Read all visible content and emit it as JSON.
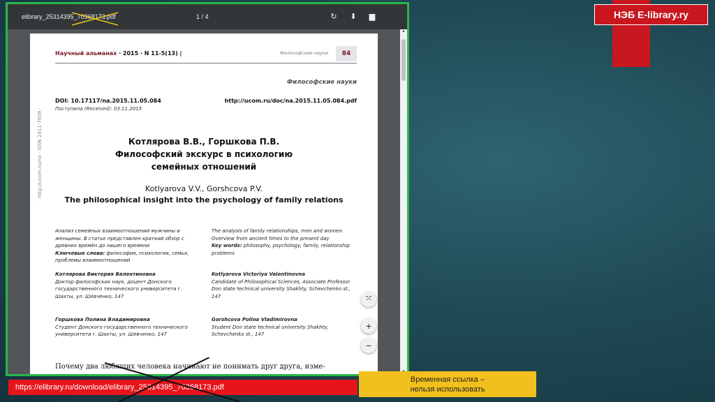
{
  "brand": {
    "label": "НЭБ E-library.ry"
  },
  "viewer": {
    "filename": "elibrary_25314395_70368173.pdf",
    "pages": "1 / 4"
  },
  "paper": {
    "journal": "Научный альманах",
    "issue": " · 2015 · N 11-5(13) |",
    "section_header": "Философские науки",
    "page_number": "84",
    "side_text": "· http://ucom.ru/na · ISSN 2411-7609 ·",
    "section": "Философские науки",
    "doi": "DOI: 10.17117/na.2015.11.05.084",
    "url": "http://ucom.ru/doc/na.2015.11.05.084.pdf",
    "received": "Поступила (Received): 03.11.2015",
    "authors_ru": "Котлярова В.В., Горшкова П.В.",
    "title_ru_1": "Философский экскурс в психологию",
    "title_ru_2": "семейных отношений",
    "authors_en": "Kotlyarova V.V., Gorshcova P.V.",
    "title_en": "The philosophical insight into the psychology of family relations",
    "abstract_ru": "Анализ семейных взаимоотношений мужчины и женщины. В статье представлен краткий обзор с древних времён до нашего времени",
    "keywords_ru_label": "Ключевые слова:",
    "keywords_ru": " философия, психология, семья, проблемы взаимоотношений",
    "abstract_en": "The analysis of family relationships, men and women. Overview from ancient times to the present day",
    "keywords_en_label": "Key words:",
    "keywords_en": " philosophy, psychology, family, relationship problems",
    "author1_ru_name": "Котлярова Виктория Валентиновна",
    "author1_ru_info": "Доктор философских наук, доцент Донского государственного технического университета г. Шахты, ул. Шевченко, 147",
    "author1_en_name": "Kotlyarova Victoriya Valentinovna",
    "author1_en_info": "Candidate of Philosophical Sciences, Associate Professor Don state technical university Shakhty, Schevchenko st., 147",
    "author2_ru_name": "Горшкова Полина Владимировна",
    "author2_ru_info": "Студент Донского государственного технического университета г. Шахты, ул. Шевченко, 147",
    "author2_en_name": "Gorshcova Polina Vladimirovna",
    "author2_en_info": "Student Don state technical university Shakhty, Schevchenko st., 147",
    "body_start": "Почему два любящих человека начинают не понимать друг друга, изме-"
  },
  "link": "https://elibrary.ru/download/elibrary_25314395_70368173.pdf",
  "note": {
    "line1": "Временная ссылка –",
    "line2": "нельзя использовать"
  },
  "colors": {
    "brand_red": "#c8171f",
    "frame_green": "#2db54a",
    "note_yellow": "#f2c01c",
    "link_red": "#e8141c"
  },
  "icons": [
    "rotate-icon",
    "download-icon",
    "print-icon",
    "fit-page-icon",
    "zoom-in-icon",
    "zoom-out-icon"
  ]
}
